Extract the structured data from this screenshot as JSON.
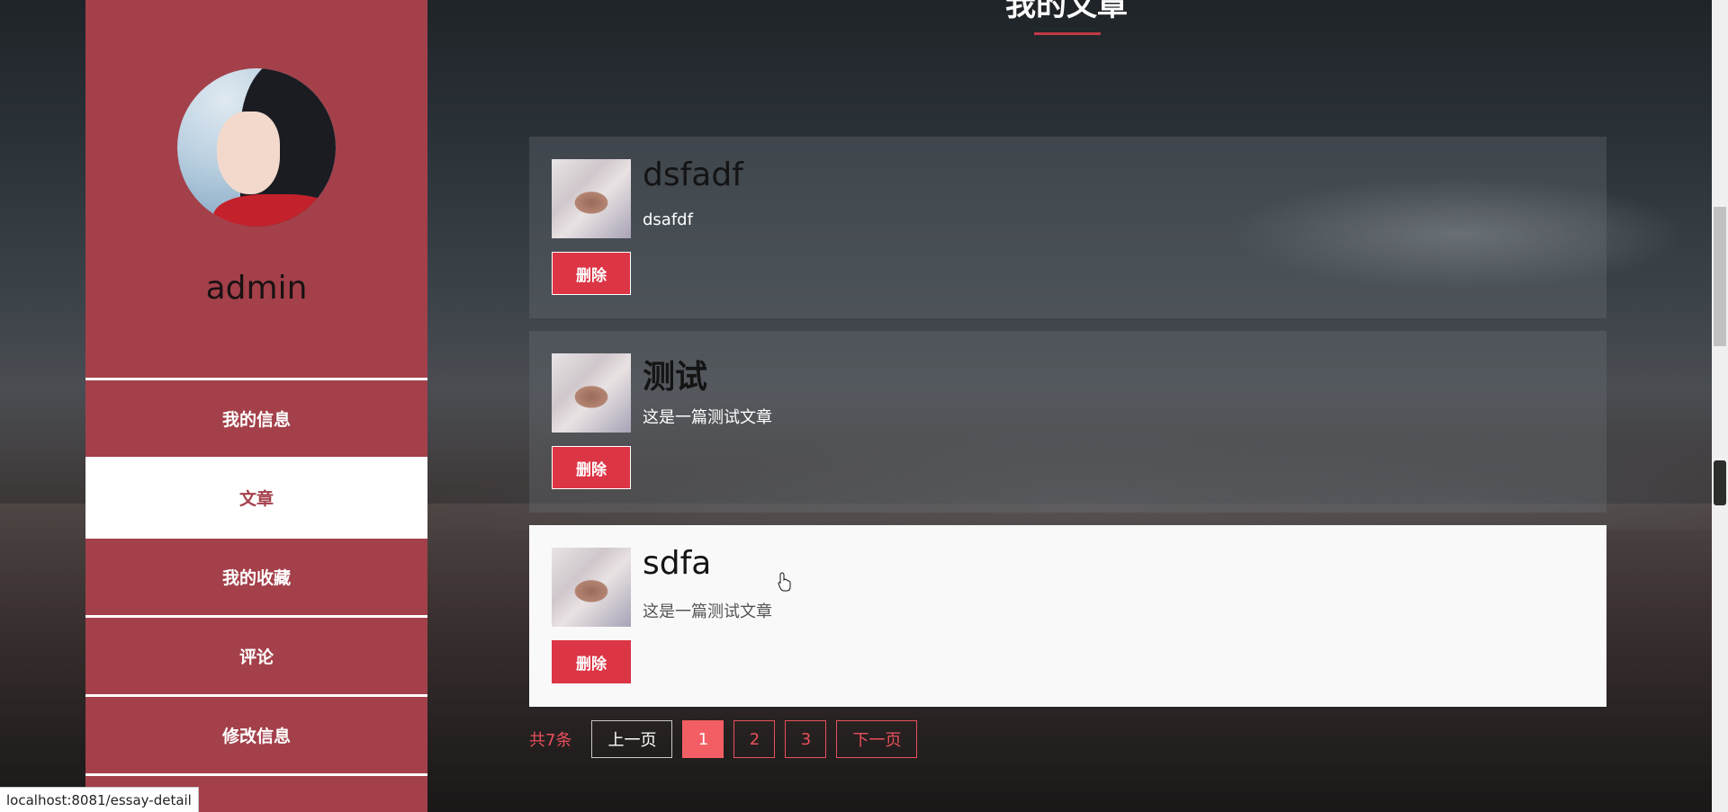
{
  "page": {
    "title": "我的文章"
  },
  "sidebar": {
    "username": "admin",
    "nav": [
      {
        "label": "我的信息",
        "active": false
      },
      {
        "label": "文章",
        "active": true
      },
      {
        "label": "我的收藏",
        "active": false
      },
      {
        "label": "评论",
        "active": false
      },
      {
        "label": "修改信息",
        "active": false
      },
      {
        "label": "",
        "active": false
      }
    ]
  },
  "articles": [
    {
      "title": "dsfadf",
      "desc": "dsafdf",
      "delete_label": "删除"
    },
    {
      "title": "测试",
      "desc": "这是一篇测试文章",
      "delete_label": "删除"
    },
    {
      "title": "sdfa",
      "desc": "这是一篇测试文章",
      "delete_label": "删除",
      "hovered": true
    }
  ],
  "pagination": {
    "total": "共7条",
    "prev": "上一页",
    "pages": [
      "1",
      "2",
      "3"
    ],
    "current": "1",
    "next": "下一页"
  },
  "status_bar": {
    "url": "localhost:8081/essay-detail"
  },
  "colors": {
    "sidebar": "#a3404a",
    "accent": "#dc3545",
    "pager": "#e8505b"
  }
}
